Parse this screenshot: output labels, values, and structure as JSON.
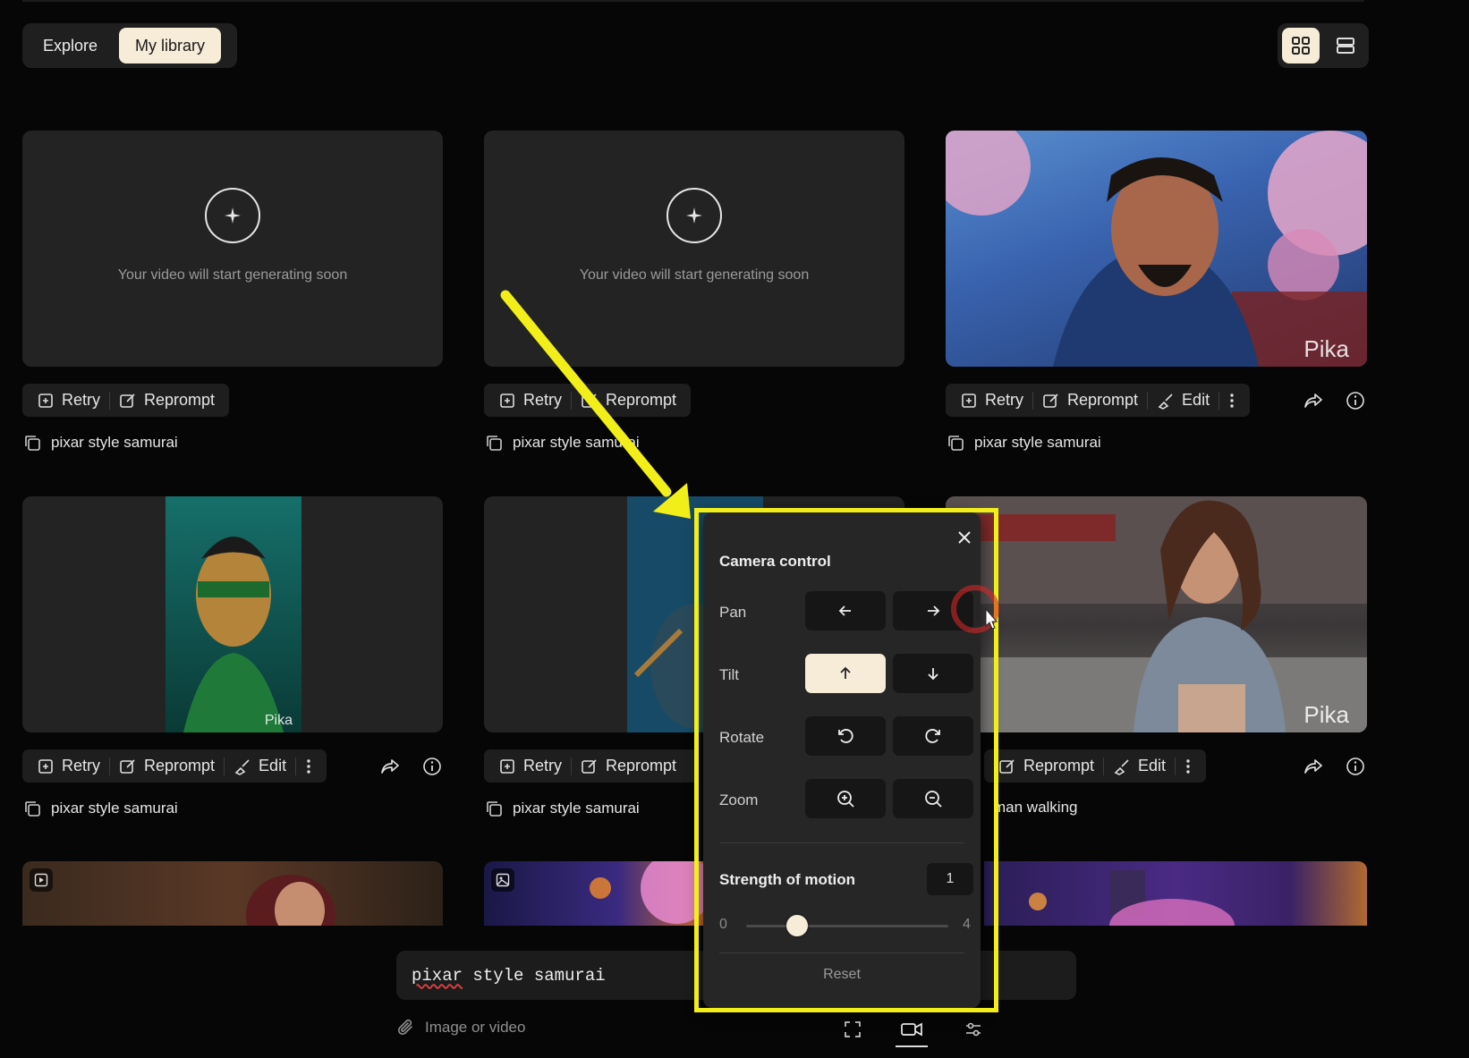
{
  "tabs": {
    "explore": "Explore",
    "library": "My library"
  },
  "generating_text": "Your video will start generating soon",
  "toolbar": {
    "retry": "Retry",
    "reprompt": "Reprompt",
    "edit": "Edit"
  },
  "watermark": "Pika",
  "cards": [
    {
      "prompt": "pixar style samurai"
    },
    {
      "prompt": "pixar style samurai"
    },
    {
      "prompt": "pixar style samurai"
    },
    {
      "prompt": "pixar style samurai"
    },
    {
      "prompt": "pixar style samurai"
    },
    {
      "prompt": "man walking"
    }
  ],
  "prompt_input": {
    "word1": "pixar",
    "rest": " style samurai"
  },
  "attach_label": "Image or video",
  "camera_control": {
    "title": "Camera control",
    "pan": "Pan",
    "tilt": "Tilt",
    "rotate": "Rotate",
    "zoom": "Zoom",
    "strength_title": "Strength of motion",
    "strength_value": "1",
    "min": "0",
    "max": "4",
    "reset": "Reset"
  },
  "colors": {
    "accent": "#f7ecd8",
    "highlight": "#f2ee1a",
    "bg": "#060606",
    "card": "#232323"
  }
}
